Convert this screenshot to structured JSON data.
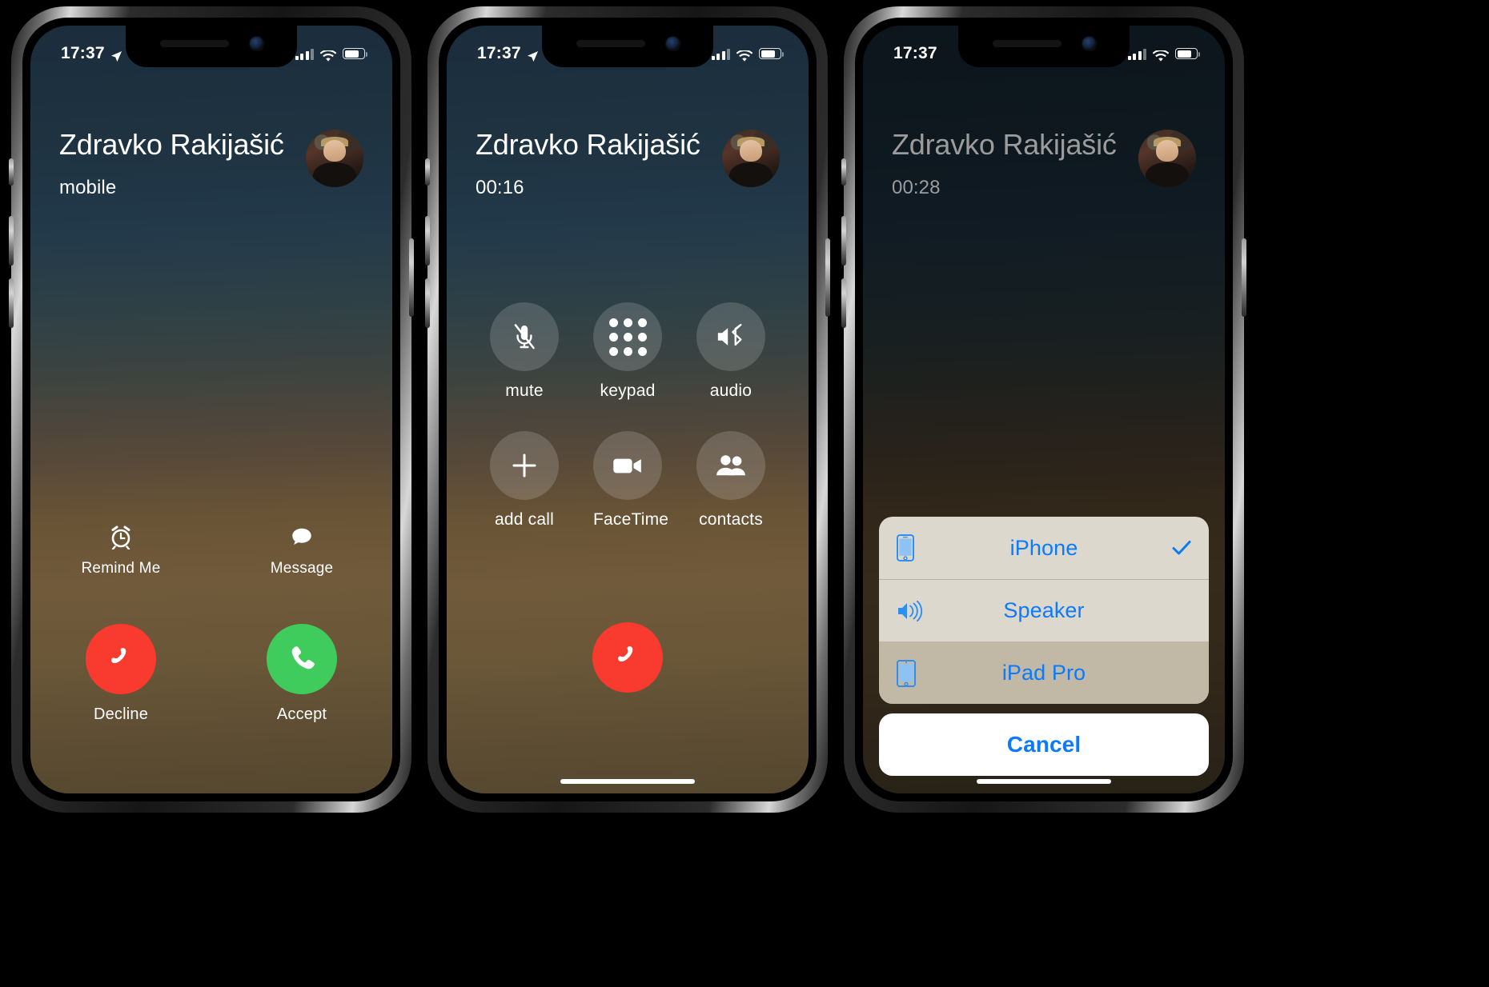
{
  "phones": [
    {
      "id": "incoming-call",
      "status_bar": {
        "time": "17:37",
        "location_icon": "location-arrow-icon",
        "signal_icon": "cellular-bars-icon",
        "wifi_icon": "wifi-icon",
        "battery_icon": "battery-icon"
      },
      "caller": {
        "name": "Zdravko Rakijašić",
        "subtitle": "mobile",
        "avatar": "contact-photo"
      },
      "secondary_actions": [
        {
          "label": "Remind Me",
          "icon": "alarm-clock-icon"
        },
        {
          "label": "Message",
          "icon": "message-bubble-icon"
        }
      ],
      "primary_actions": [
        {
          "label": "Decline",
          "icon": "end-call-icon",
          "color": "#f93a2f"
        },
        {
          "label": "Accept",
          "icon": "phone-icon",
          "color": "#3fcc5c"
        }
      ]
    },
    {
      "id": "active-call",
      "status_bar": {
        "time": "17:37",
        "location_icon": "location-arrow-icon",
        "signal_icon": "cellular-bars-icon",
        "wifi_icon": "wifi-icon",
        "battery_icon": "battery-icon"
      },
      "caller": {
        "name": "Zdravko Rakijašić",
        "subtitle": "00:16",
        "avatar": "contact-photo"
      },
      "controls": [
        {
          "label": "mute",
          "icon": "microphone-muted-icon"
        },
        {
          "label": "keypad",
          "icon": "keypad-dots-icon"
        },
        {
          "label": "audio",
          "icon": "speaker-bluetooth-icon"
        },
        {
          "label": "add call",
          "icon": "plus-icon"
        },
        {
          "label": "FaceTime",
          "icon": "video-camera-icon"
        },
        {
          "label": "contacts",
          "icon": "contacts-people-icon"
        }
      ],
      "end_call": {
        "label": "",
        "icon": "end-call-icon",
        "color": "#f93a2f"
      }
    },
    {
      "id": "audio-route-picker",
      "status_bar": {
        "time": "17:37",
        "signal_icon": "cellular-bars-icon",
        "wifi_icon": "wifi-icon",
        "battery_icon": "battery-icon"
      },
      "caller": {
        "name": "Zdravko Rakijašić",
        "subtitle": "00:28",
        "avatar": "contact-photo"
      },
      "sheet": {
        "options": [
          {
            "label": "iPhone",
            "icon": "iphone-device-icon",
            "selected": true,
            "pressed": false
          },
          {
            "label": "Speaker",
            "icon": "speaker-waves-icon",
            "selected": false,
            "pressed": false
          },
          {
            "label": "iPad Pro",
            "icon": "ipad-device-icon",
            "selected": false,
            "pressed": true
          }
        ],
        "cancel_label": "Cancel",
        "accent_color": "#0b7bfb"
      }
    }
  ]
}
